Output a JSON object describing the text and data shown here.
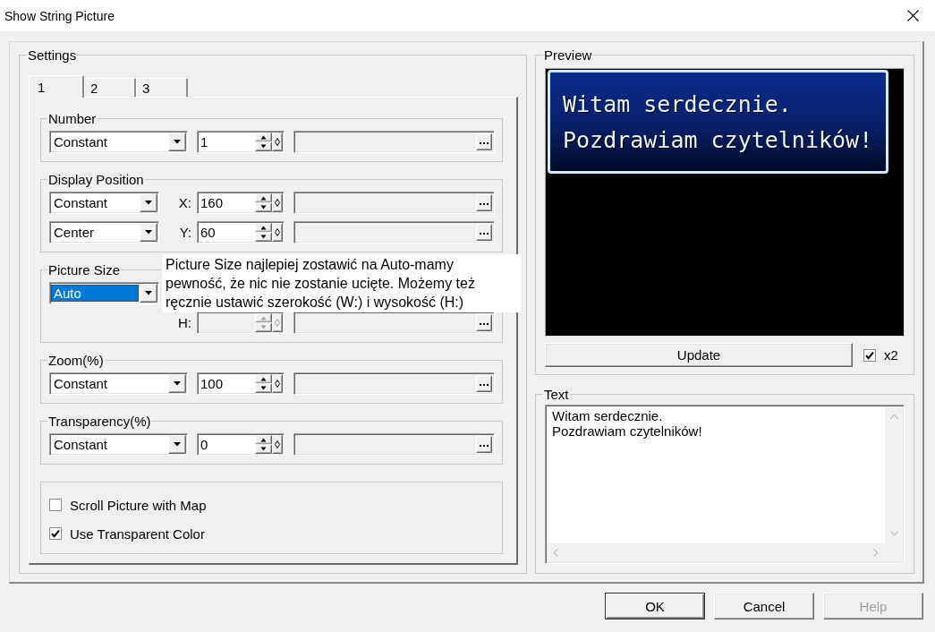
{
  "window": {
    "title": "Show String Picture"
  },
  "settings": {
    "title": "Settings",
    "tabs": [
      {
        "label": "1",
        "selected": true
      },
      {
        "label": "2",
        "selected": false
      },
      {
        "label": "3",
        "selected": false
      }
    ],
    "groups": [
      {
        "title": "Number",
        "kind": "single",
        "rows": [
          {
            "kind": "combo-spin",
            "mode": "Constant",
            "focused": false,
            "value": "1",
            "disabled": false
          }
        ]
      },
      {
        "title": "Display Position",
        "kind": "xy",
        "rows": [
          {
            "kind": "combo-spin",
            "mode": "Constant",
            "focused": false,
            "axis": "X:",
            "value": "160",
            "disabled": false
          },
          {
            "kind": "combo-spin",
            "mode": "Center",
            "focused": false,
            "axis": "Y:",
            "value": "60",
            "disabled": false
          }
        ]
      },
      {
        "title": "Picture Size",
        "kind": "xy",
        "rows": [
          {
            "kind": "combo",
            "mode": "Auto",
            "focused": true,
            "disabled": false
          },
          {
            "kind": "spin",
            "axis": "H:",
            "disabled": true
          }
        ],
        "tooltip": "Picture Size najlepiej zostawić na Auto-mamy pewność, że nic nie zostanie ucięte. Możemy też ręcznie ustawić szerokość (W:) i wysokość (H:)"
      },
      {
        "title": "Zoom(%)",
        "kind": "single",
        "rows": [
          {
            "kind": "combo-spin",
            "mode": "Constant",
            "focused": false,
            "value": "100",
            "disabled": false
          }
        ]
      },
      {
        "title": "Transparency(%)",
        "kind": "single",
        "rows": [
          {
            "kind": "combo-spin",
            "mode": "Constant",
            "focused": false,
            "value": "0",
            "disabled": false
          }
        ]
      }
    ],
    "options": [
      {
        "label": "Scroll Picture with Map",
        "checked": false
      },
      {
        "label": "Use Transparent Color",
        "checked": true
      }
    ]
  },
  "preview": {
    "title": "Preview",
    "message": [
      "Witam serdecznie.",
      "Pozdrawiam czytelników!"
    ],
    "update_button": "Update",
    "double_size": {
      "label": "x2",
      "checked": true
    }
  },
  "text": {
    "title": "Text",
    "value": "Witam serdecznie.\nPozdrawiam czytelników!"
  },
  "buttons": [
    {
      "label": "OK",
      "default": true,
      "disabled": false
    },
    {
      "label": "Cancel",
      "default": false,
      "disabled": false
    },
    {
      "label": "Help",
      "default": false,
      "disabled": true
    }
  ]
}
